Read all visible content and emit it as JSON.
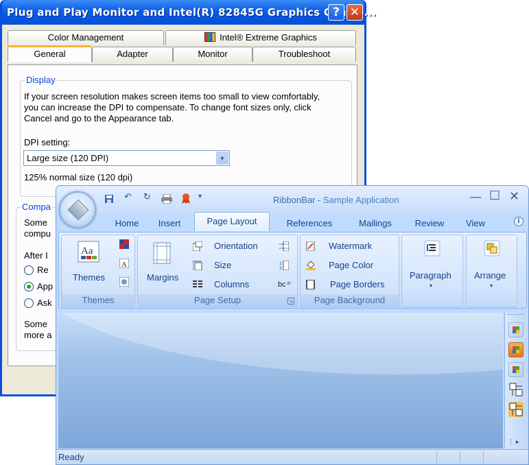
{
  "dialog": {
    "title": "Plug and Play Monitor and Intel(R) 82845G Graphics Contro...",
    "help_glyph": "?",
    "close_glyph": "✕",
    "tabs_back": [
      "Color Management",
      "Intel® Extreme Graphics"
    ],
    "tabs_front": [
      "General",
      "Adapter",
      "Monitor",
      "Troubleshoot"
    ],
    "selected_tab": "General",
    "display_group": {
      "label": "Display",
      "description": [
        "If your screen resolution makes screen items too small to view comfortably,",
        "you can increase the DPI to compensate.  To change font sizes only, click",
        "Cancel and go to the Appearance tab."
      ],
      "dpi_label": "DPI setting:",
      "dpi_value": "Large size (120 DPI)",
      "dpi_note": "125% normal size (120 dpi)"
    },
    "compat_group": {
      "label": "Compa",
      "text1": [
        "Some",
        "compu"
      ],
      "after_label": "After I",
      "radios": [
        {
          "label": "Re",
          "checked": false
        },
        {
          "label": "App",
          "checked": true
        },
        {
          "label": "Ask",
          "checked": false
        }
      ],
      "text2": [
        "Some",
        "more a"
      ]
    }
  },
  "ribbon_window": {
    "title": "RibbonBar",
    "title_sep": " - ",
    "app_name": "Sample Application",
    "quick_access": [
      "save-icon",
      "undo-icon",
      "redo-icon",
      "print-icon",
      "award-icon",
      "customize-icon"
    ],
    "window_controls": {
      "minimize": "—",
      "maximize": "☐",
      "close": "✕"
    },
    "tabs": [
      "Home",
      "Insert",
      "Page Layout",
      "References",
      "Mailings",
      "Review",
      "View"
    ],
    "selected_tab": "Page Layout",
    "help_glyph": "i",
    "groups": {
      "themes": {
        "label": "Themes",
        "button": "Themes"
      },
      "page_setup": {
        "label": "Page Setup",
        "margins": "Margins",
        "orientation": "Orientation",
        "size": "Size",
        "columns": "Columns"
      },
      "page_background": {
        "label": "Page Background",
        "watermark": "Watermark",
        "page_color": "Page Color",
        "page_borders": "Page Borders"
      },
      "paragraph": {
        "label": "Paragraph"
      },
      "arrange": {
        "label": "Arrange"
      }
    },
    "status": "Ready",
    "colors": {
      "accent": "#15428b",
      "ribbon_bg": "#bfdbff",
      "tab_text": "#15428b"
    }
  }
}
